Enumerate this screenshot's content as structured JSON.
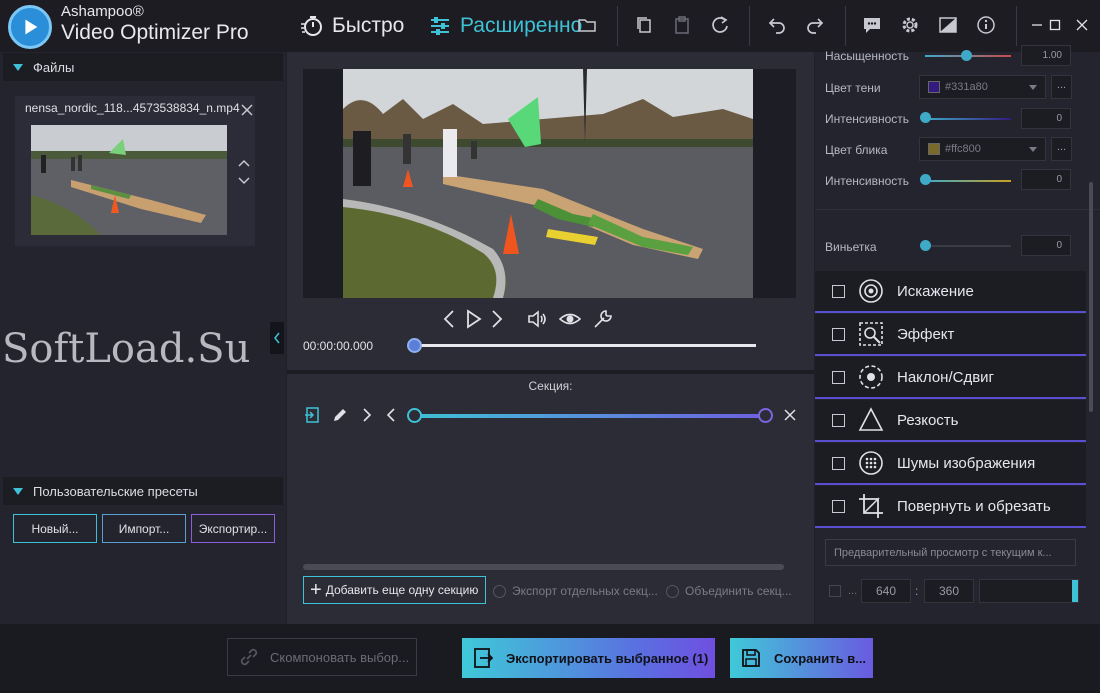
{
  "app": {
    "brand_top": "Ashampoo®",
    "brand_main": "Video Optimizer Pro",
    "mode_fast": "Быстро",
    "mode_advanced": "Расширенно"
  },
  "files": {
    "header": "Файлы",
    "file_name": "nensa_nordic_118...4573538834_n.mp4"
  },
  "watermark": "SoftLoad.Su",
  "presets": {
    "header": "Пользовательские пресеты",
    "new_label": "Новый...",
    "import_label": "Импорт...",
    "export_label": "Экспортир..."
  },
  "player": {
    "time": "00:00:00.000",
    "section_label": "Секция:",
    "add_section_label": "Добавить еще одну секцию",
    "export_separate_label": "Экспорт отдельных секц...",
    "merge_label": "Объединить секц..."
  },
  "settings": {
    "saturation_label": "Насыщенность",
    "saturation_value": "1.00",
    "shadow_color_label": "Цвет тени",
    "shadow_color_value": "#331a80",
    "intensity1_label": "Интенсивность",
    "intensity1_value": "0",
    "highlight_color_label": "Цвет блика",
    "highlight_color_value": "#ffc800",
    "intensity2_label": "Интенсивность",
    "intensity2_value": "0",
    "vignette_label": "Виньетка",
    "vignette_value": "0",
    "more_label": "...",
    "effects": [
      {
        "label": "Искажение",
        "icon": "distortion-icon"
      },
      {
        "label": "Эффект",
        "icon": "effect-icon"
      },
      {
        "label": "Наклон/Сдвиг",
        "icon": "tilt-shift-icon"
      },
      {
        "label": "Резкость",
        "icon": "sharpness-icon"
      },
      {
        "label": "Шумы изображения",
        "icon": "noise-icon"
      },
      {
        "label": "Повернуть и обрезать",
        "icon": "crop-icon"
      }
    ],
    "preview_label": "Предварительный просмотр с текущим к...",
    "res_dots": "...",
    "res_width": "640",
    "res_sep": ":",
    "res_height": "360"
  },
  "bottom": {
    "compose_label": "Скомпоновать выбор...",
    "export_selected_label": "Экспортировать выбранное (1)",
    "save_label": "Сохранить в..."
  },
  "colors": {
    "accent": "#3fc1d6",
    "accent2": "#6f4fe0",
    "shadow_swatch": "#331a80",
    "highlight_swatch": "#ffc800"
  }
}
